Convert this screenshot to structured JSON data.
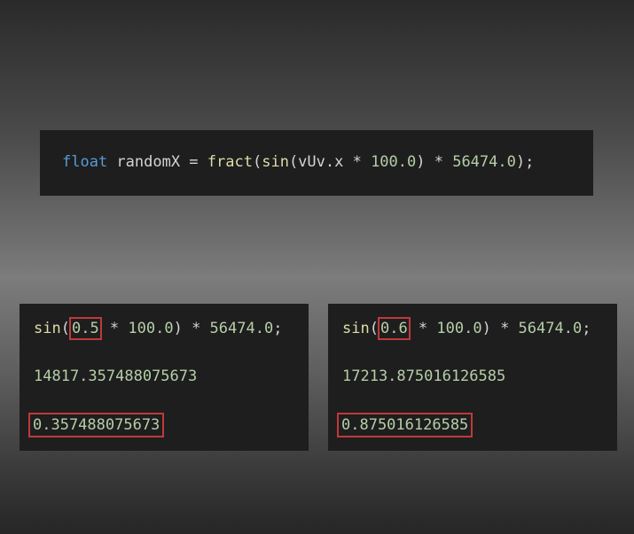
{
  "main_code": {
    "keyword": "float",
    "variable": " randomX = ",
    "fract_fn": "fract",
    "paren_open": "(",
    "sin_fn": "sin",
    "inner_open": "(vUv.x * ",
    "multiplier": "100.0",
    "inner_close": ") * ",
    "scale": "56474.0",
    "end": ");"
  },
  "examples": [
    {
      "sin_fn": "sin",
      "open_paren": "(",
      "input": "0.5",
      "mid": " * ",
      "multiplier": "100.0",
      "close": ") * ",
      "scale": "56474.0",
      "semicolon": ";",
      "product": "14817.357488075673",
      "fract_result": "0.357488075673"
    },
    {
      "sin_fn": "sin",
      "open_paren": "(",
      "input": "0.6",
      "mid": " * ",
      "multiplier": "100.0",
      "close": ") * ",
      "scale": "56474.0",
      "semicolon": ";",
      "product": "17213.875016126585",
      "fract_result": "0.875016126585"
    }
  ],
  "colors": {
    "keyword": "#569cd6",
    "function": "#dcdcaa",
    "number": "#b5cea8",
    "text": "#d4d4d4",
    "panel": "#1e1e1e",
    "highlight_box": "#c0393b"
  }
}
